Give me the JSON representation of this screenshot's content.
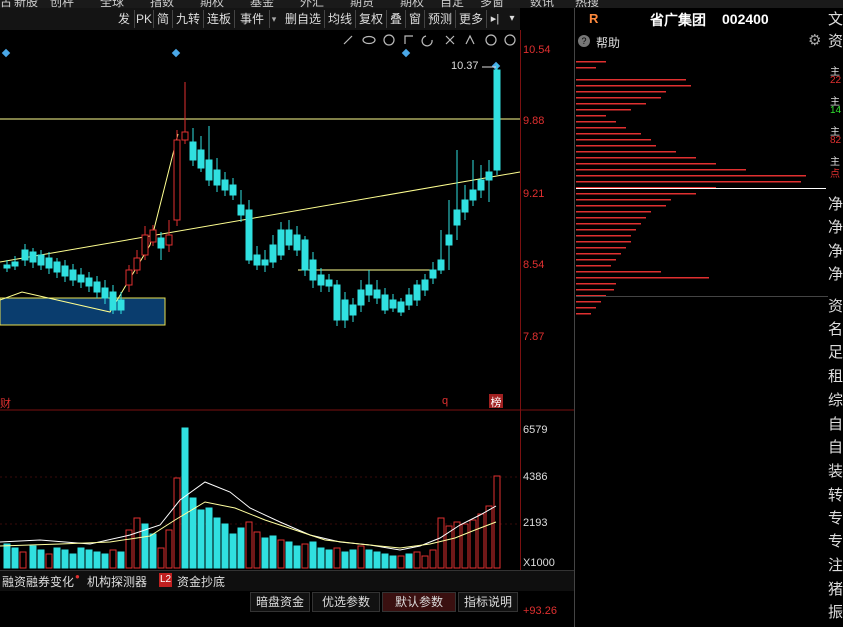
{
  "top_menu": [
    "古",
    "新股",
    "创秤",
    "全球",
    "指数",
    "期权",
    "基金",
    "外汇",
    "期货",
    "期权",
    "自定",
    "多窗",
    "数讯",
    "热搜"
  ],
  "toolbar": {
    "buttons": [
      "发",
      "PK",
      "简",
      "九转",
      "连板",
      "事件"
    ],
    "buttons2": [
      "删自选",
      "均线",
      "复权",
      "叠",
      "窗",
      "预测",
      "更多"
    ],
    "expand_icon": "▸|",
    "dropdown_icon": "▾"
  },
  "price_axis": [
    "10.54",
    "9.88",
    "9.21",
    "8.54",
    "7.87"
  ],
  "price_label": "10.37",
  "markers": {
    "left": "财",
    "q": "q",
    "right": "榜"
  },
  "volume_axis": [
    "6579",
    "4386",
    "2193",
    "X1000"
  ],
  "stock": {
    "flag": "R",
    "name": "省广集团",
    "code": "002400"
  },
  "help_label": "帮助",
  "right_edge": [
    "文",
    "资",
    "净",
    "净",
    "净",
    "净",
    "资",
    "名",
    "足",
    "租",
    "综",
    "自",
    "自",
    "装",
    "转",
    "专",
    "专",
    "注",
    "猪",
    "振"
  ],
  "right_small": [
    "主",
    "22",
    "主",
    "14",
    "主",
    "82",
    "主",
    "点"
  ],
  "bottom_tabs": [
    "融资融券变化",
    "机构探测器",
    "L2",
    "资金抄底"
  ],
  "bottom_tabs2": [
    "暗盘资金",
    "优选参数",
    "默认参数",
    "指标说明"
  ],
  "bottom_value": "+93.26",
  "colors": {
    "up": "#e03030",
    "down": "#30e0e0",
    "line_yellow": "#ffff80",
    "line_white": "#ffffff",
    "highlight_box": "#0a3d6e"
  }
}
